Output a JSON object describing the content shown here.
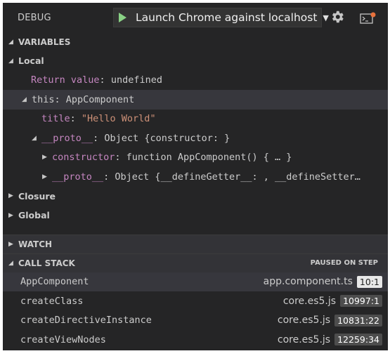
{
  "toolbar": {
    "title": "DEBUG",
    "launch_config": "Launch Chrome against localhost",
    "dropdown_glyph": "▼",
    "icons": [
      "play-icon",
      "gear-icon",
      "debug-console-icon"
    ]
  },
  "variables": {
    "header": "VARIABLES",
    "local_label": "Local",
    "return_name": "Return value",
    "return_value": "undefined",
    "this_name": "this",
    "this_value": "AppComponent",
    "title_name": "title",
    "title_value": "\"Hello World\"",
    "proto_name": "__proto__",
    "proto_value": "Object {constructor: }",
    "constructor_name": "constructor",
    "constructor_value": "function AppComponent() { … }",
    "proto2_name": "__proto__",
    "proto2_value": "Object {__defineGetter__: , __defineSetter…",
    "closure_label": "Closure",
    "global_label": "Global"
  },
  "watch": {
    "header": "WATCH"
  },
  "call_stack": {
    "header": "CALL STACK",
    "status": "PAUSED ON STEP",
    "frames": [
      {
        "name": "AppComponent",
        "file": "app.component.ts",
        "pos": "10:1"
      },
      {
        "name": "createClass",
        "file": "core.es5.js",
        "pos": "10997:1"
      },
      {
        "name": "createDirectiveInstance",
        "file": "core.es5.js",
        "pos": "10831:22"
      },
      {
        "name": "createViewNodes",
        "file": "core.es5.js",
        "pos": "12259:34"
      }
    ]
  },
  "colors": {
    "background": "#252526",
    "play": "#89d185",
    "keyword": "#c586c0",
    "string": "#ce9178"
  }
}
